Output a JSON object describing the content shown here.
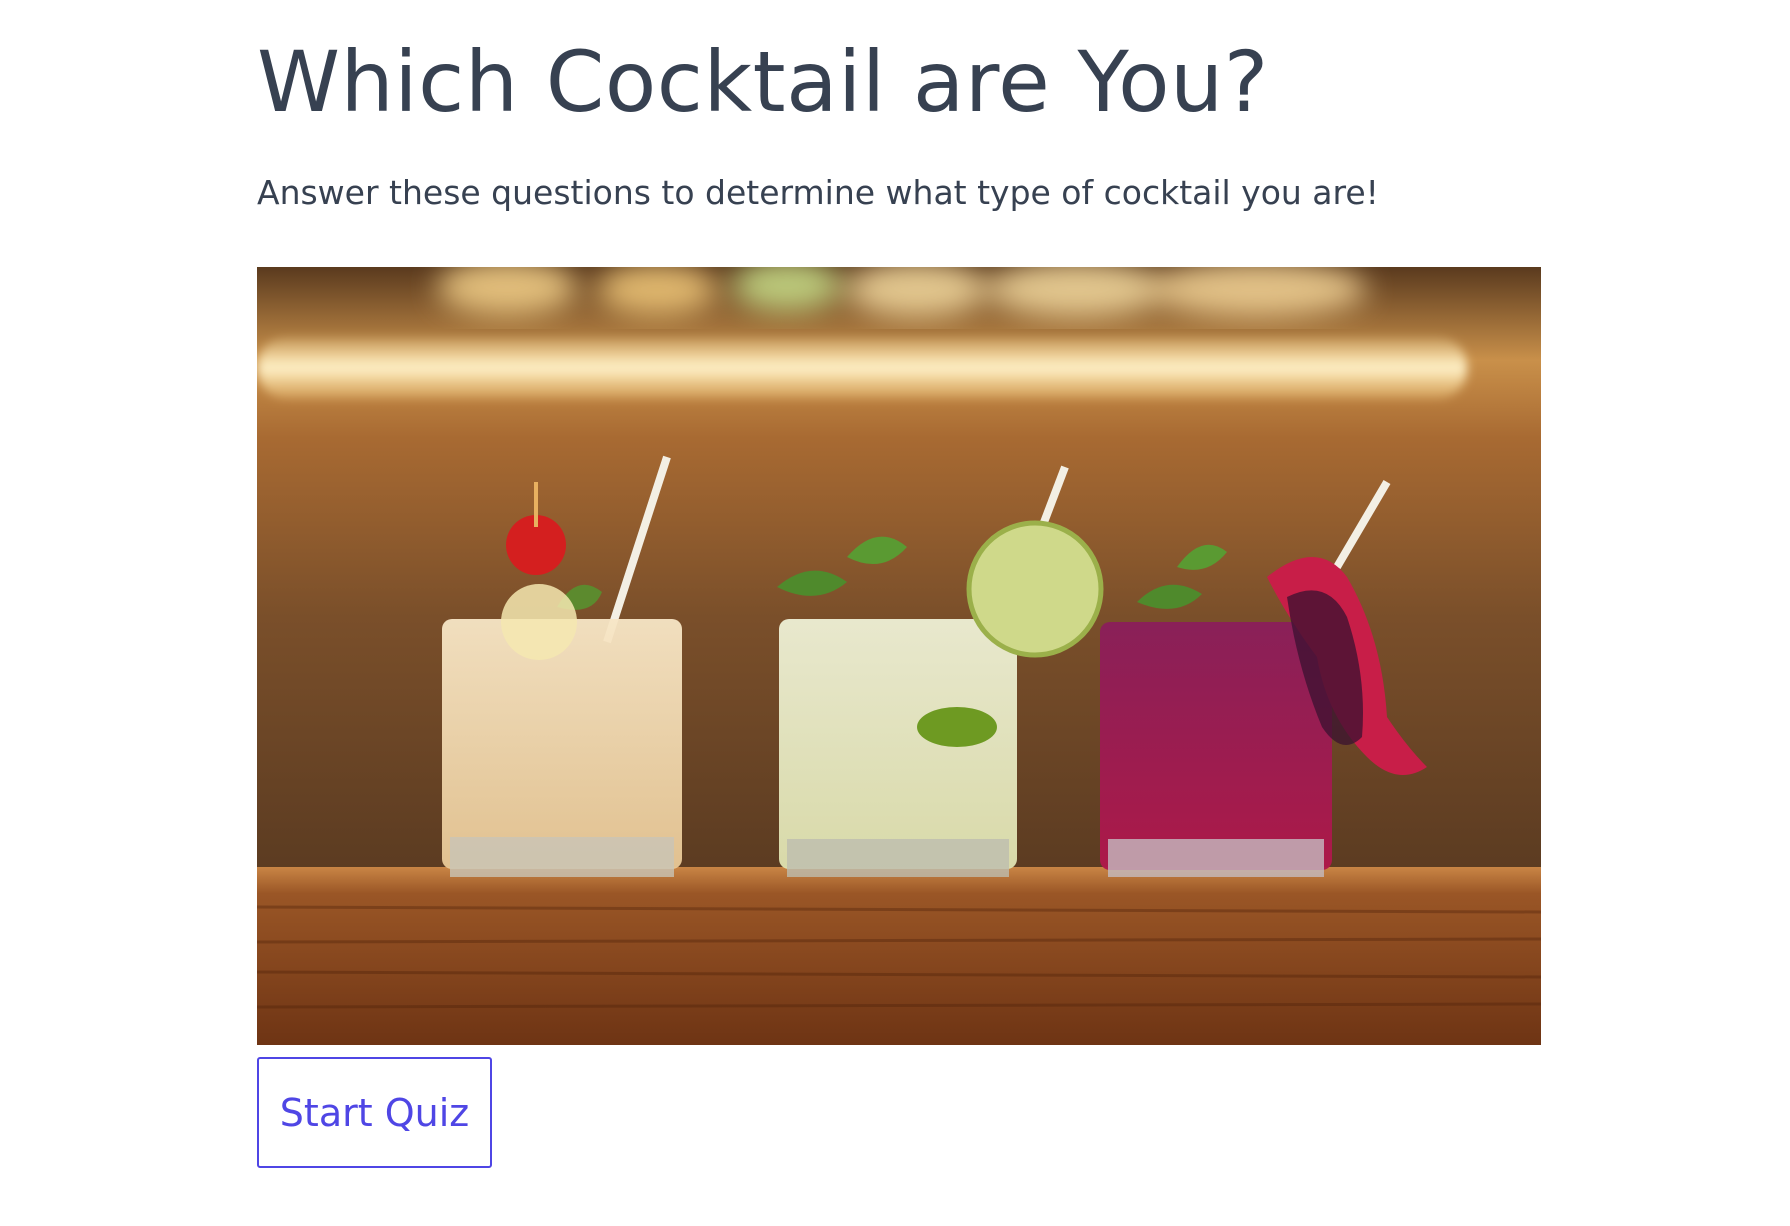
{
  "quiz": {
    "title": "Which Cocktail are You?",
    "subtitle": "Answer these questions to determine what type of cocktail you are!",
    "hero_image": {
      "alt": "Three cocktails on a wooden bar counter"
    },
    "start_button_label": "Start Quiz"
  },
  "colors": {
    "text": "#374151",
    "accent": "#4f46e5",
    "background": "#ffffff"
  }
}
